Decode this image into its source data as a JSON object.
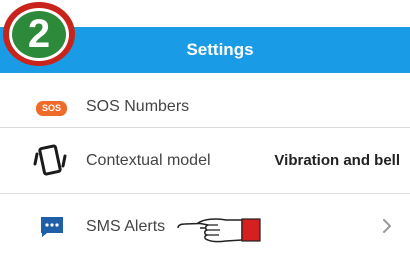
{
  "header": {
    "title": "Settings"
  },
  "step_badge": {
    "number": "2"
  },
  "list": {
    "items": [
      {
        "icon": "sos-icon",
        "icon_text": "SOS",
        "label": "SOS Numbers"
      },
      {
        "icon": "vibrate-icon",
        "label": "Contextual model",
        "value": "Vibration and bell"
      },
      {
        "icon": "sms-chat-icon",
        "label": "SMS Alerts"
      }
    ]
  },
  "colors": {
    "header_bg": "#1a9be6",
    "badge_outer": "#c9241b",
    "badge_inner": "#2d8a3a",
    "sos_icon": "#f06a2a",
    "sms_icon": "#1e5fa8",
    "hand_cuff": "#d61f1f"
  }
}
